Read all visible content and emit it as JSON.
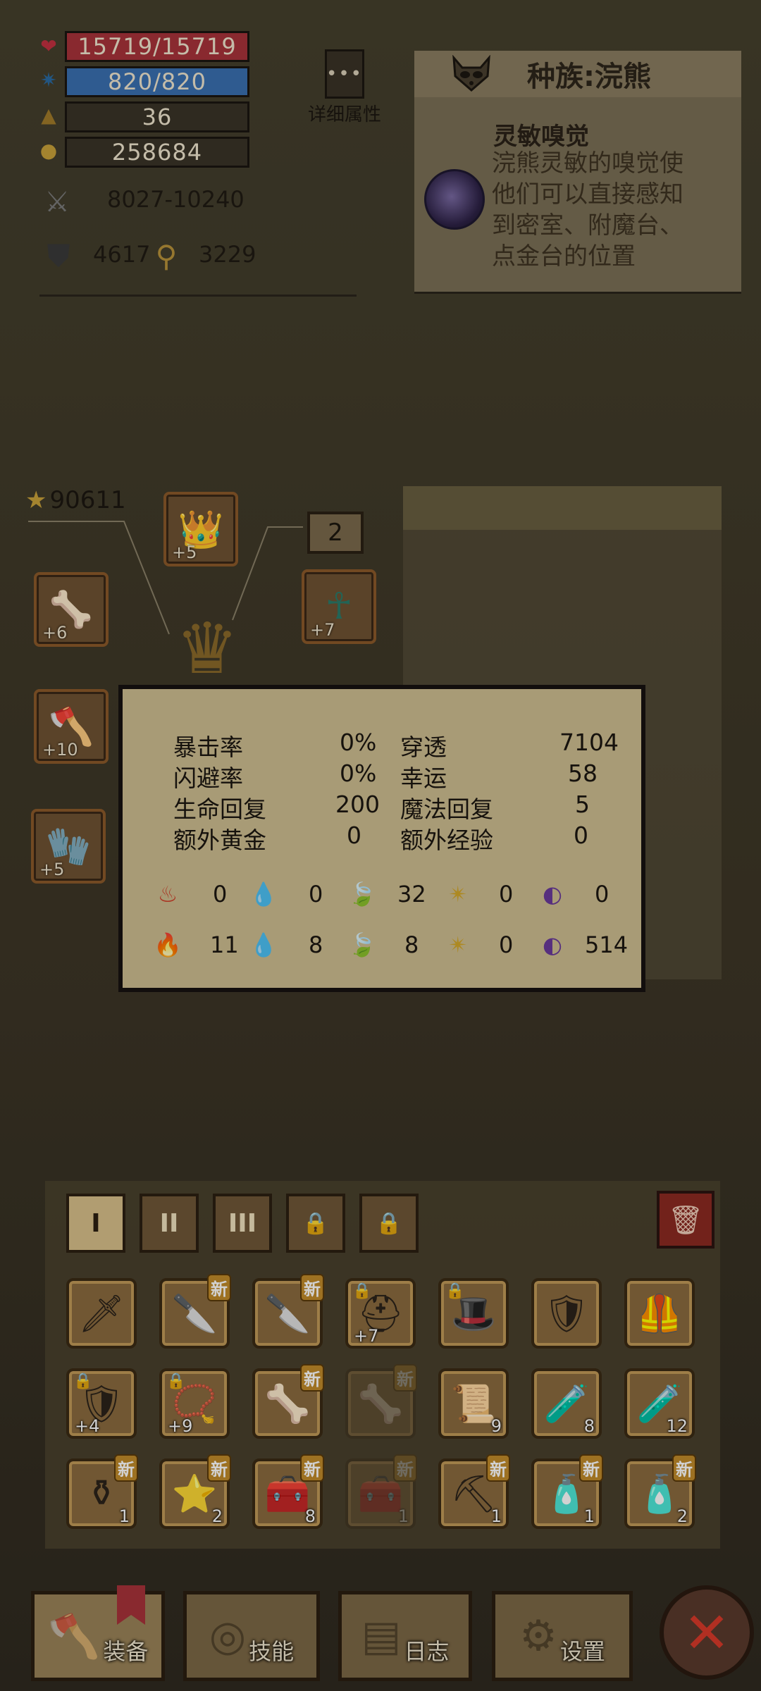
{
  "stats": {
    "hp": "15719/15719",
    "mp": "820/820",
    "level": "36",
    "gold": "258684",
    "attack": "8027-10240",
    "defense": "4617",
    "magic_defense": "3229"
  },
  "detail_button": {
    "dots": "•••",
    "label": "详细属性"
  },
  "race": {
    "title": "种族:浣熊",
    "trait_name": "灵敏嗅觉",
    "trait_desc": "浣熊灵敏的嗅觉使他们可以直接感知到密室、附魔台、点金台的位置"
  },
  "power_score": "90611",
  "equipment": {
    "slot_number": "2",
    "helmet_level": "+5",
    "ring_level": "+6",
    "amulet_level": "+7",
    "weapon_level": "+10",
    "gloves_level": "+5"
  },
  "tooltip": {
    "rows": [
      {
        "label1": "暴击率",
        "value1": "0%",
        "label2": "穿透",
        "value2": "7104"
      },
      {
        "label1": "闪避率",
        "value1": "0%",
        "label2": "幸运",
        "value2": "58"
      },
      {
        "label1": "生命回复",
        "value1": "200",
        "label2": "魔法回复",
        "value2": "5"
      },
      {
        "label1": "额外黄金",
        "value1": "0",
        "label2": "额外经验",
        "value2": "0"
      }
    ],
    "attack_elements": [
      "0",
      "0",
      "32",
      "0",
      "0"
    ],
    "resist_elements": [
      "11",
      "8",
      "8",
      "0",
      "514"
    ]
  },
  "inventory": {
    "tabs": [
      "I",
      "II",
      "III",
      "🔒",
      "🔒"
    ],
    "new_badge": "新",
    "items": [
      {
        "icon": "sword-icon",
        "glyph": "🗡",
        "count": "",
        "badge": false,
        "faded": false,
        "locked": false
      },
      {
        "icon": "dagger-icon",
        "glyph": "🔪",
        "count": "",
        "badge": true,
        "faded": false,
        "locked": false
      },
      {
        "icon": "dagger-icon",
        "glyph": "🔪",
        "count": "",
        "badge": true,
        "faded": false,
        "locked": false
      },
      {
        "icon": "helmet-icon",
        "glyph": "⛑",
        "count": "+7",
        "badge": false,
        "faded": false,
        "locked": true
      },
      {
        "icon": "hat-icon",
        "glyph": "🎩",
        "count": "",
        "badge": false,
        "faded": false,
        "locked": true
      },
      {
        "icon": "shoulder-armor-icon",
        "glyph": "🛡",
        "count": "",
        "badge": false,
        "faded": false,
        "locked": false
      },
      {
        "icon": "armor-icon",
        "glyph": "🦺",
        "count": "",
        "badge": false,
        "faded": false,
        "locked": false
      },
      {
        "icon": "chest-armor-icon",
        "glyph": "🛡",
        "count": "+4",
        "badge": false,
        "faded": false,
        "locked": true
      },
      {
        "icon": "amulet-icon",
        "glyph": "📿",
        "count": "+9",
        "badge": false,
        "faded": false,
        "locked": true
      },
      {
        "icon": "bone-club-icon",
        "glyph": "🦴",
        "count": "",
        "badge": true,
        "faded": false,
        "locked": false
      },
      {
        "icon": "bone-icon",
        "glyph": "🦴",
        "count": "",
        "badge": true,
        "faded": true,
        "locked": false
      },
      {
        "icon": "scroll-icon",
        "glyph": "📜",
        "count": "9",
        "badge": false,
        "faded": false,
        "locked": false
      },
      {
        "icon": "red-potion-icon",
        "glyph": "🧪",
        "count": "8",
        "badge": false,
        "faded": false,
        "locked": false
      },
      {
        "icon": "blue-potion-icon",
        "glyph": "🧪",
        "count": "12",
        "badge": false,
        "faded": false,
        "locked": false
      },
      {
        "icon": "yellow-potion-icon",
        "glyph": "⚱",
        "count": "1",
        "badge": true,
        "faded": false,
        "locked": false
      },
      {
        "icon": "pink-star-potion-icon",
        "glyph": "⭐",
        "count": "2",
        "badge": true,
        "faded": false,
        "locked": false
      },
      {
        "icon": "treasure-chest-icon",
        "glyph": "🧰",
        "count": "8",
        "badge": true,
        "faded": false,
        "locked": false
      },
      {
        "icon": "chest-icon",
        "glyph": "🧰",
        "count": "1",
        "badge": true,
        "faded": true,
        "locked": false
      },
      {
        "icon": "pickaxe-icon",
        "glyph": "⛏",
        "count": "1",
        "badge": true,
        "faded": false,
        "locked": false
      },
      {
        "icon": "blue-flask-icon",
        "glyph": "🧴",
        "count": "1",
        "badge": true,
        "faded": false,
        "locked": false
      },
      {
        "icon": "red-flask-icon",
        "glyph": "🧴",
        "count": "2",
        "badge": true,
        "faded": false,
        "locked": false
      }
    ]
  },
  "nav": {
    "equip": "装备",
    "skills": "技能",
    "log": "日志",
    "settings": "设置"
  },
  "colors": {
    "hp_bar": "#a8323a",
    "mp_bar": "#3a6fb0",
    "tooltip_bg": "#cdbd91"
  }
}
